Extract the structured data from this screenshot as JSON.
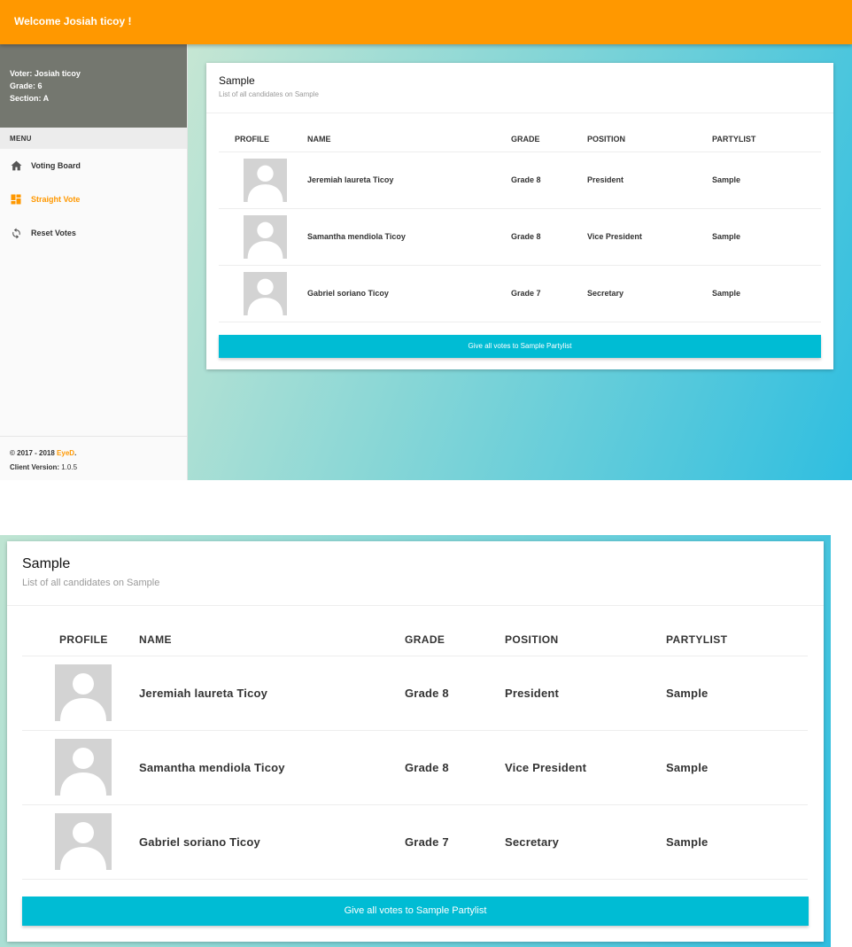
{
  "header": {
    "title": "Welcome Josiah ticoy !"
  },
  "sidebar": {
    "voter": "Voter: Josiah ticoy",
    "grade": "Grade: 6",
    "section": "Section: A",
    "menu_header": "MENU",
    "items": [
      {
        "label": "Voting Board",
        "icon": "home-icon",
        "active": false
      },
      {
        "label": "Straight Vote",
        "icon": "dashboard-icon",
        "active": true
      },
      {
        "label": "Reset Votes",
        "icon": "refresh-icon",
        "active": false
      }
    ],
    "footer": {
      "copyright": "© 2017 - 2018 ",
      "brand": "EyeD",
      "period": ".",
      "version_label": "Client Version:",
      "version": "1.0.5"
    }
  },
  "card": {
    "title": "Sample",
    "subtitle": "List of all candidates on Sample",
    "columns": [
      "PROFILE",
      "NAME",
      "GRADE",
      "POSITION",
      "PARTYLIST"
    ],
    "rows": [
      {
        "name": "Jeremiah laureta Ticoy",
        "grade": "Grade 8",
        "position": "President",
        "partylist": "Sample"
      },
      {
        "name": "Samantha mendiola Ticoy",
        "grade": "Grade 8",
        "position": "Vice President",
        "partylist": "Sample"
      },
      {
        "name": "Gabriel soriano Ticoy",
        "grade": "Grade 7",
        "position": "Secretary",
        "partylist": "Sample"
      }
    ],
    "button": "Give all votes to Sample Partylist"
  },
  "colors": {
    "topbar": "#ff9800",
    "accent": "#ff9800",
    "button": "#00bcd4",
    "user_panel": "#74776f"
  }
}
